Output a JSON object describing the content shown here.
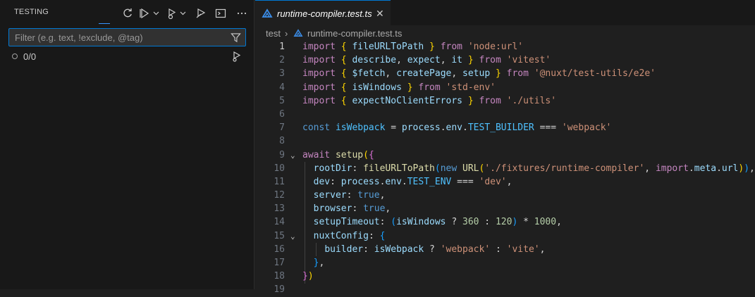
{
  "sidebar": {
    "title": "TESTING",
    "filter": {
      "placeholder": "Filter (e.g. text, !exclude, @tag)",
      "value": ""
    },
    "result": "0/0",
    "actions": [
      "refresh-icon",
      "run-tests-icon",
      "debug-tests-icon",
      "run-coverage-icon",
      "show-output-icon",
      "more-actions-icon"
    ]
  },
  "editor": {
    "tab": {
      "label": "runtime-compiler.test.ts",
      "icon": "typescript-test-icon"
    },
    "breadcrumb": {
      "folder": "test",
      "file": "runtime-compiler.test.ts"
    },
    "lines": [
      {
        "n": "1",
        "t": [
          [
            "kw",
            "import"
          ],
          [
            "pl",
            " "
          ],
          [
            "br",
            "{"
          ],
          [
            "pl",
            " "
          ],
          [
            "vr",
            "fileURLToPath"
          ],
          [
            "pl",
            " "
          ],
          [
            "br",
            "}"
          ],
          [
            "pl",
            " "
          ],
          [
            "kw",
            "from"
          ],
          [
            "pl",
            " "
          ],
          [
            "str",
            "'node:url'"
          ]
        ]
      },
      {
        "n": "2",
        "t": [
          [
            "kw",
            "import"
          ],
          [
            "pl",
            " "
          ],
          [
            "br",
            "{"
          ],
          [
            "pl",
            " "
          ],
          [
            "vr",
            "describe"
          ],
          [
            "pl",
            ", "
          ],
          [
            "vr",
            "expect"
          ],
          [
            "pl",
            ", "
          ],
          [
            "vr",
            "it"
          ],
          [
            "pl",
            " "
          ],
          [
            "br",
            "}"
          ],
          [
            "pl",
            " "
          ],
          [
            "kw",
            "from"
          ],
          [
            "pl",
            " "
          ],
          [
            "str",
            "'vitest'"
          ]
        ]
      },
      {
        "n": "3",
        "t": [
          [
            "kw",
            "import"
          ],
          [
            "pl",
            " "
          ],
          [
            "br",
            "{"
          ],
          [
            "pl",
            " "
          ],
          [
            "vr",
            "$fetch"
          ],
          [
            "pl",
            ", "
          ],
          [
            "vr",
            "createPage"
          ],
          [
            "pl",
            ", "
          ],
          [
            "vr",
            "setup"
          ],
          [
            "pl",
            " "
          ],
          [
            "br",
            "}"
          ],
          [
            "pl",
            " "
          ],
          [
            "kw",
            "from"
          ],
          [
            "pl",
            " "
          ],
          [
            "str",
            "'@nuxt/test-utils/e2e'"
          ]
        ]
      },
      {
        "n": "4",
        "t": [
          [
            "kw",
            "import"
          ],
          [
            "pl",
            " "
          ],
          [
            "br",
            "{"
          ],
          [
            "pl",
            " "
          ],
          [
            "vr",
            "isWindows"
          ],
          [
            "pl",
            " "
          ],
          [
            "br",
            "}"
          ],
          [
            "pl",
            " "
          ],
          [
            "kw",
            "from"
          ],
          [
            "pl",
            " "
          ],
          [
            "str",
            "'std-env'"
          ]
        ]
      },
      {
        "n": "5",
        "t": [
          [
            "kw",
            "import"
          ],
          [
            "pl",
            " "
          ],
          [
            "br",
            "{"
          ],
          [
            "pl",
            " "
          ],
          [
            "vr",
            "expectNoClientErrors"
          ],
          [
            "pl",
            " "
          ],
          [
            "br",
            "}"
          ],
          [
            "pl",
            " "
          ],
          [
            "kw",
            "from"
          ],
          [
            "pl",
            " "
          ],
          [
            "str",
            "'./utils'"
          ]
        ]
      },
      {
        "n": "6",
        "t": []
      },
      {
        "n": "7",
        "t": [
          [
            "kw2",
            "const"
          ],
          [
            "pl",
            " "
          ],
          [
            "cn",
            "isWebpack"
          ],
          [
            "pl",
            " = "
          ],
          [
            "vr",
            "process"
          ],
          [
            "pl",
            "."
          ],
          [
            "vr",
            "env"
          ],
          [
            "pl",
            "."
          ],
          [
            "cn",
            "TEST_BUILDER"
          ],
          [
            "pl",
            " === "
          ],
          [
            "str",
            "'webpack'"
          ]
        ]
      },
      {
        "n": "8",
        "t": []
      },
      {
        "n": "9",
        "fold": true,
        "t": [
          [
            "kw",
            "await"
          ],
          [
            "pl",
            " "
          ],
          [
            "fn",
            "setup"
          ],
          [
            "br",
            "("
          ],
          [
            "br2",
            "{"
          ]
        ]
      },
      {
        "n": "10",
        "t": [
          [
            "pl",
            "  "
          ],
          [
            "vr",
            "rootDir"
          ],
          [
            "pl",
            ": "
          ],
          [
            "fn",
            "fileURLToPath"
          ],
          [
            "br3",
            "("
          ],
          [
            "kw2",
            "new"
          ],
          [
            "pl",
            " "
          ],
          [
            "fn",
            "URL"
          ],
          [
            "br",
            "("
          ],
          [
            "str",
            "'./fixtures/runtime-compiler'"
          ],
          [
            "pl",
            ", "
          ],
          [
            "kw",
            "import"
          ],
          [
            "pl",
            "."
          ],
          [
            "vr",
            "meta"
          ],
          [
            "pl",
            "."
          ],
          [
            "vr",
            "url"
          ],
          [
            "br",
            ")"
          ],
          [
            "br3",
            ")"
          ],
          [
            "pl",
            ","
          ]
        ]
      },
      {
        "n": "11",
        "t": [
          [
            "pl",
            "  "
          ],
          [
            "vr",
            "dev"
          ],
          [
            "pl",
            ": "
          ],
          [
            "vr",
            "process"
          ],
          [
            "pl",
            "."
          ],
          [
            "vr",
            "env"
          ],
          [
            "pl",
            "."
          ],
          [
            "cn",
            "TEST_ENV"
          ],
          [
            "pl",
            " === "
          ],
          [
            "str",
            "'dev'"
          ],
          [
            "pl",
            ","
          ]
        ]
      },
      {
        "n": "12",
        "t": [
          [
            "pl",
            "  "
          ],
          [
            "vr",
            "server"
          ],
          [
            "pl",
            ": "
          ],
          [
            "kw2",
            "true"
          ],
          [
            "pl",
            ","
          ]
        ]
      },
      {
        "n": "13",
        "t": [
          [
            "pl",
            "  "
          ],
          [
            "vr",
            "browser"
          ],
          [
            "pl",
            ": "
          ],
          [
            "kw2",
            "true"
          ],
          [
            "pl",
            ","
          ]
        ]
      },
      {
        "n": "14",
        "t": [
          [
            "pl",
            "  "
          ],
          [
            "vr",
            "setupTimeout"
          ],
          [
            "pl",
            ": "
          ],
          [
            "br3",
            "("
          ],
          [
            "vr",
            "isWindows"
          ],
          [
            "pl",
            " ? "
          ],
          [
            "num",
            "360"
          ],
          [
            "pl",
            " : "
          ],
          [
            "num",
            "120"
          ],
          [
            "br3",
            ")"
          ],
          [
            "pl",
            " * "
          ],
          [
            "num",
            "1000"
          ],
          [
            "pl",
            ","
          ]
        ]
      },
      {
        "n": "15",
        "fold": true,
        "t": [
          [
            "pl",
            "  "
          ],
          [
            "vr",
            "nuxtConfig"
          ],
          [
            "pl",
            ": "
          ],
          [
            "br3",
            "{"
          ]
        ]
      },
      {
        "n": "16",
        "t": [
          [
            "pl",
            "    "
          ],
          [
            "vr",
            "builder"
          ],
          [
            "pl",
            ": "
          ],
          [
            "vr",
            "isWebpack"
          ],
          [
            "pl",
            " ? "
          ],
          [
            "str",
            "'webpack'"
          ],
          [
            "pl",
            " : "
          ],
          [
            "str",
            "'vite'"
          ],
          [
            "pl",
            ","
          ]
        ]
      },
      {
        "n": "17",
        "t": [
          [
            "pl",
            "  "
          ],
          [
            "br3",
            "}"
          ],
          [
            "pl",
            ","
          ]
        ]
      },
      {
        "n": "18",
        "t": [
          [
            "br2",
            "}"
          ],
          [
            "br",
            ")"
          ]
        ]
      },
      {
        "n": "19",
        "t": []
      }
    ]
  }
}
